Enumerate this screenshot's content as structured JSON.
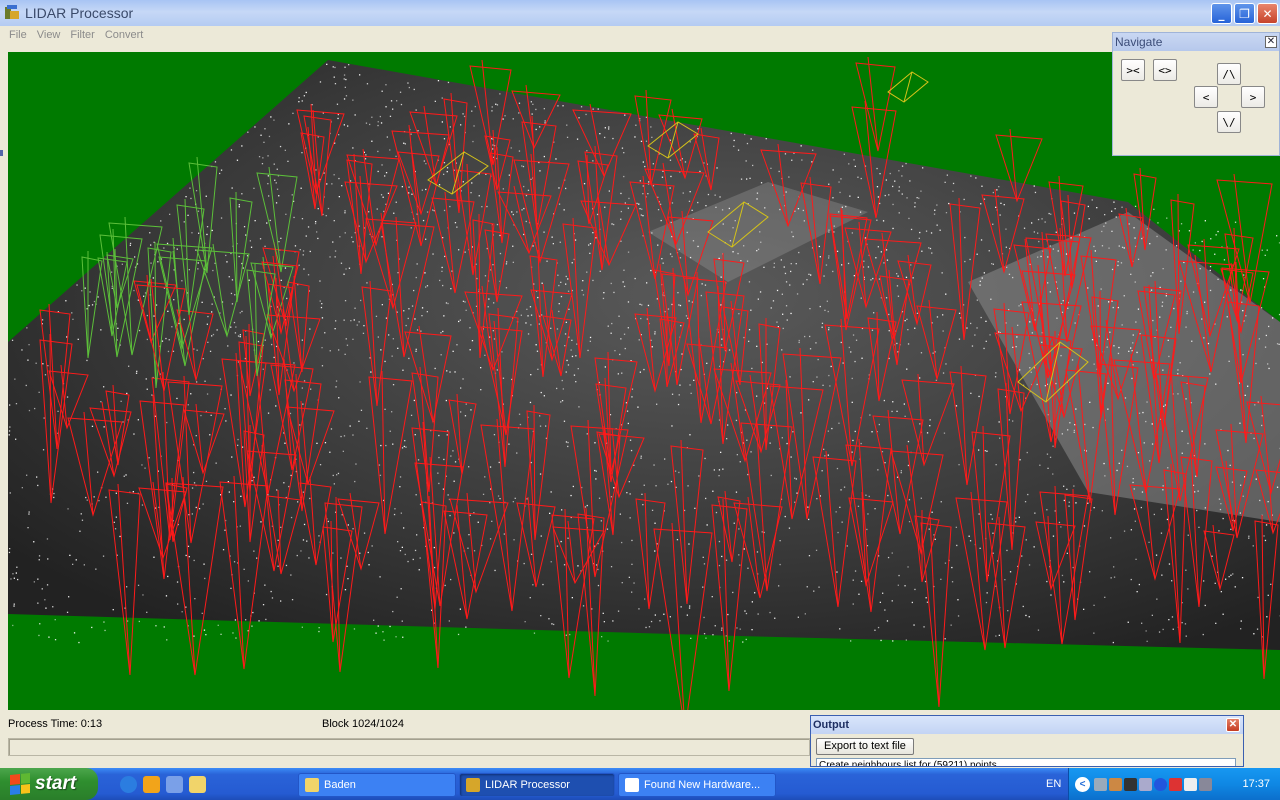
{
  "window": {
    "title": "LIDAR Processor",
    "minimize": "_",
    "maximize": "❐",
    "close": "✕"
  },
  "menu": [
    {
      "id": "file",
      "label": "File"
    },
    {
      "id": "view",
      "label": "View"
    },
    {
      "id": "filter",
      "label": "Filter"
    },
    {
      "id": "convert",
      "label": "Convert"
    }
  ],
  "navigate": {
    "title": "Navigate",
    "close": "✕",
    "zoom_in": "><",
    "zoom_out": "<>",
    "up": "/\\",
    "down": "\\/",
    "left": "<",
    "right": ">"
  },
  "status": {
    "process_time": "Process Time: 0:13",
    "block": "Block 1024/1024"
  },
  "output": {
    "title": "Output",
    "close": "✕",
    "export_label": "Export to text file",
    "log_line": "Create neighbours list for (59211) points"
  },
  "taskbar": {
    "start_label": "start",
    "tasks": [
      {
        "label": "Baden"
      },
      {
        "label": "LIDAR Processor"
      },
      {
        "label": "Found New Hardware..."
      }
    ],
    "language": "EN",
    "clock": "17:37"
  },
  "colors": {
    "viewport_background": "#007a00",
    "terrain": "#3a3a3a",
    "tree_wireframe": "#ff1a1a",
    "building_wireframe": "#d4c21a",
    "points": "#ffffff"
  }
}
